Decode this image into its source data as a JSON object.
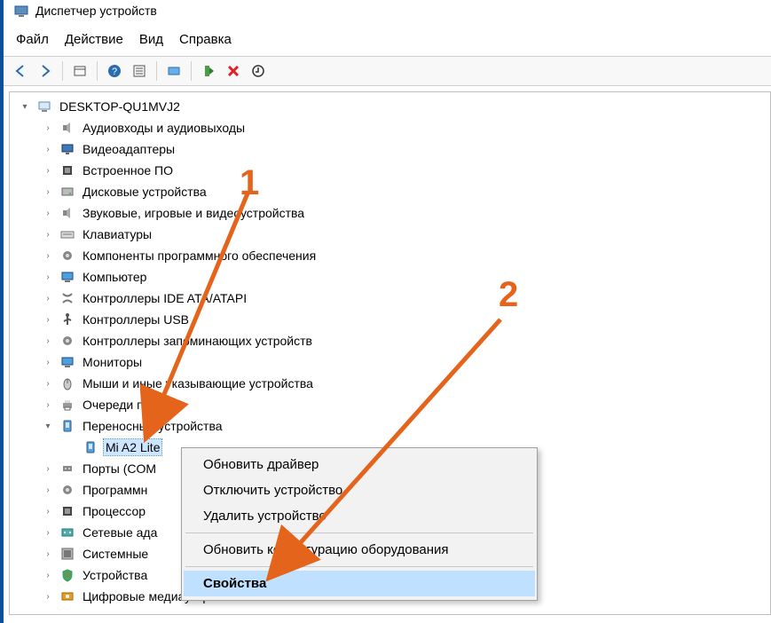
{
  "window": {
    "title": "Диспетчер устройств"
  },
  "menu": {
    "file": "Файл",
    "action": "Действие",
    "view": "Вид",
    "help": "Справка"
  },
  "root": {
    "label": "DESKTOP-QU1MVJ2"
  },
  "categories": [
    {
      "id": "audio-io",
      "icon": "speaker",
      "label": "Аудиовходы и аудиовыходы"
    },
    {
      "id": "video",
      "icon": "display",
      "label": "Видеоадаптеры"
    },
    {
      "id": "firmware",
      "icon": "chip",
      "label": "Встроенное ПО"
    },
    {
      "id": "disks",
      "icon": "disk",
      "label": "Дисковые устройства"
    },
    {
      "id": "sound",
      "icon": "speaker",
      "label": "Звуковые, игровые и видеоустройства"
    },
    {
      "id": "keyboards",
      "icon": "keyboard",
      "label": "Клавиатуры"
    },
    {
      "id": "software",
      "icon": "gear",
      "label": "Компоненты программного обеспечения"
    },
    {
      "id": "computer",
      "icon": "monitor",
      "label": "Компьютер"
    },
    {
      "id": "ide",
      "icon": "cable",
      "label": "Контроллеры IDE ATA/ATAPI"
    },
    {
      "id": "usb",
      "icon": "usb",
      "label": "Контроллеры USB"
    },
    {
      "id": "storage-ctrl",
      "icon": "gear",
      "label": "Контроллеры запоминающих устройств"
    },
    {
      "id": "monitors",
      "icon": "monitor",
      "label": "Мониторы"
    },
    {
      "id": "mice",
      "icon": "mouse",
      "label": "Мыши и иные указывающие устройства"
    },
    {
      "id": "print-queue",
      "icon": "printer",
      "label": "Очереди печати"
    },
    {
      "id": "portable",
      "icon": "device",
      "label": "Переносные устройства",
      "expanded": true,
      "children": [
        {
          "id": "mi-a2-lite",
          "icon": "device",
          "label": "Mi A2 Lite",
          "selected": true
        }
      ]
    },
    {
      "id": "ports",
      "icon": "port",
      "label": "Порты (COM"
    },
    {
      "id": "soft-devices",
      "icon": "gear",
      "label": "Программн"
    },
    {
      "id": "cpus",
      "icon": "chip",
      "label": "Процессор"
    },
    {
      "id": "network",
      "icon": "net",
      "label": "Сетевые ада"
    },
    {
      "id": "system",
      "icon": "system",
      "label": "Системные"
    },
    {
      "id": "security",
      "icon": "shield",
      "label": "Устройства"
    },
    {
      "id": "digital-media",
      "icon": "media",
      "label": "Цифровые медиаустройства"
    }
  ],
  "context_menu": {
    "items": [
      {
        "id": "update-driver",
        "label": "Обновить драйвер"
      },
      {
        "id": "disable-device",
        "label": "Отключить устройство"
      },
      {
        "id": "remove-device",
        "label": "Удалить устройство"
      }
    ],
    "items2": [
      {
        "id": "scan-hardware",
        "label": "Обновить конфигурацию оборудования"
      }
    ],
    "items3": [
      {
        "id": "properties",
        "label": "Свойства",
        "highlight": true
      }
    ]
  },
  "annotations": {
    "one": "1",
    "two": "2"
  }
}
